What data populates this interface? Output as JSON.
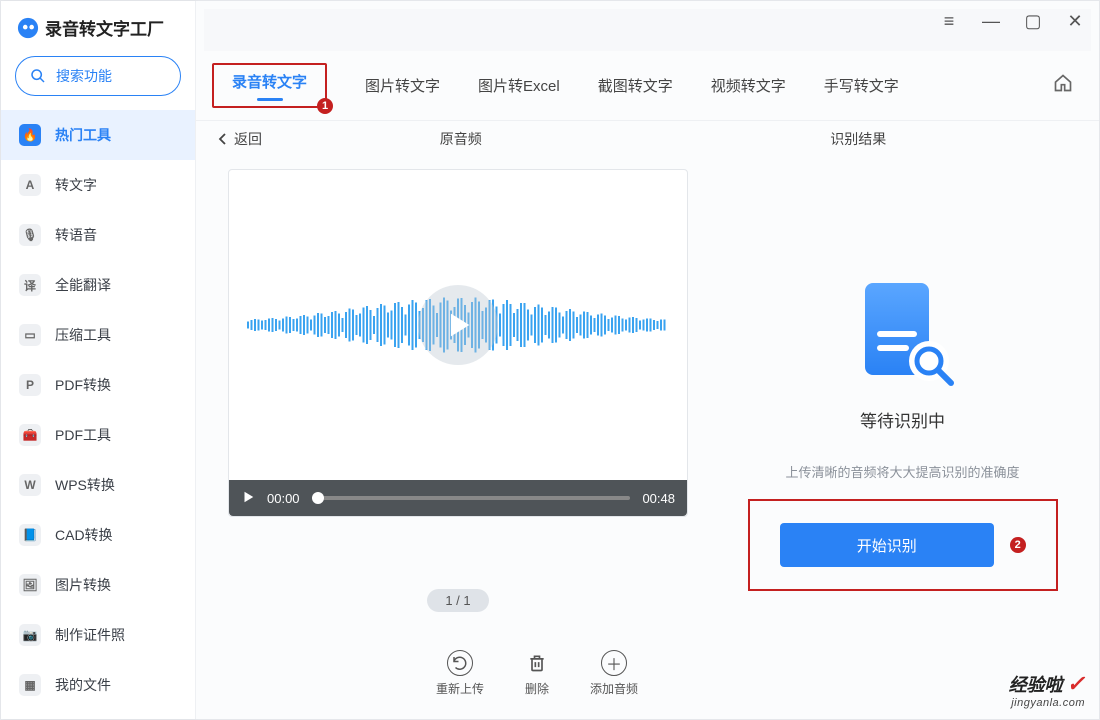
{
  "app": {
    "title": "录音转文字工厂"
  },
  "search": {
    "placeholder": "搜索功能"
  },
  "sidebar": {
    "items": [
      {
        "label": "热门工具"
      },
      {
        "label": "转文字"
      },
      {
        "label": "转语音"
      },
      {
        "label": "全能翻译"
      },
      {
        "label": "压缩工具"
      },
      {
        "label": "PDF转换"
      },
      {
        "label": "PDF工具"
      },
      {
        "label": "WPS转换"
      },
      {
        "label": "CAD转换"
      },
      {
        "label": "图片转换"
      },
      {
        "label": "制作证件照"
      },
      {
        "label": "我的文件"
      }
    ],
    "glyphs": [
      "🔥",
      "A",
      "🎙",
      "译",
      "▭",
      "P",
      "🧰",
      "W",
      "📘",
      "🖼",
      "📷",
      "▦"
    ]
  },
  "tabs": [
    {
      "label": "录音转文字"
    },
    {
      "label": "图片转文字"
    },
    {
      "label": "图片转Excel"
    },
    {
      "label": "截图转文字"
    },
    {
      "label": "视频转文字"
    },
    {
      "label": "手写转文字"
    }
  ],
  "callouts": {
    "tab": "1",
    "start": "2"
  },
  "subhead": {
    "back": "返回",
    "left": "原音频",
    "right": "识别结果"
  },
  "player": {
    "current": "00:00",
    "total": "00:48",
    "pager": "1 / 1"
  },
  "actions": {
    "reupload": "重新上传",
    "delete": "删除",
    "add": "添加音频"
  },
  "result": {
    "title": "等待识别中",
    "hint": "上传清晰的音频将大大提高识别的准确度",
    "button": "开始识别"
  },
  "watermark": {
    "line1": "经验啦",
    "line2": "jingyanla.com"
  }
}
